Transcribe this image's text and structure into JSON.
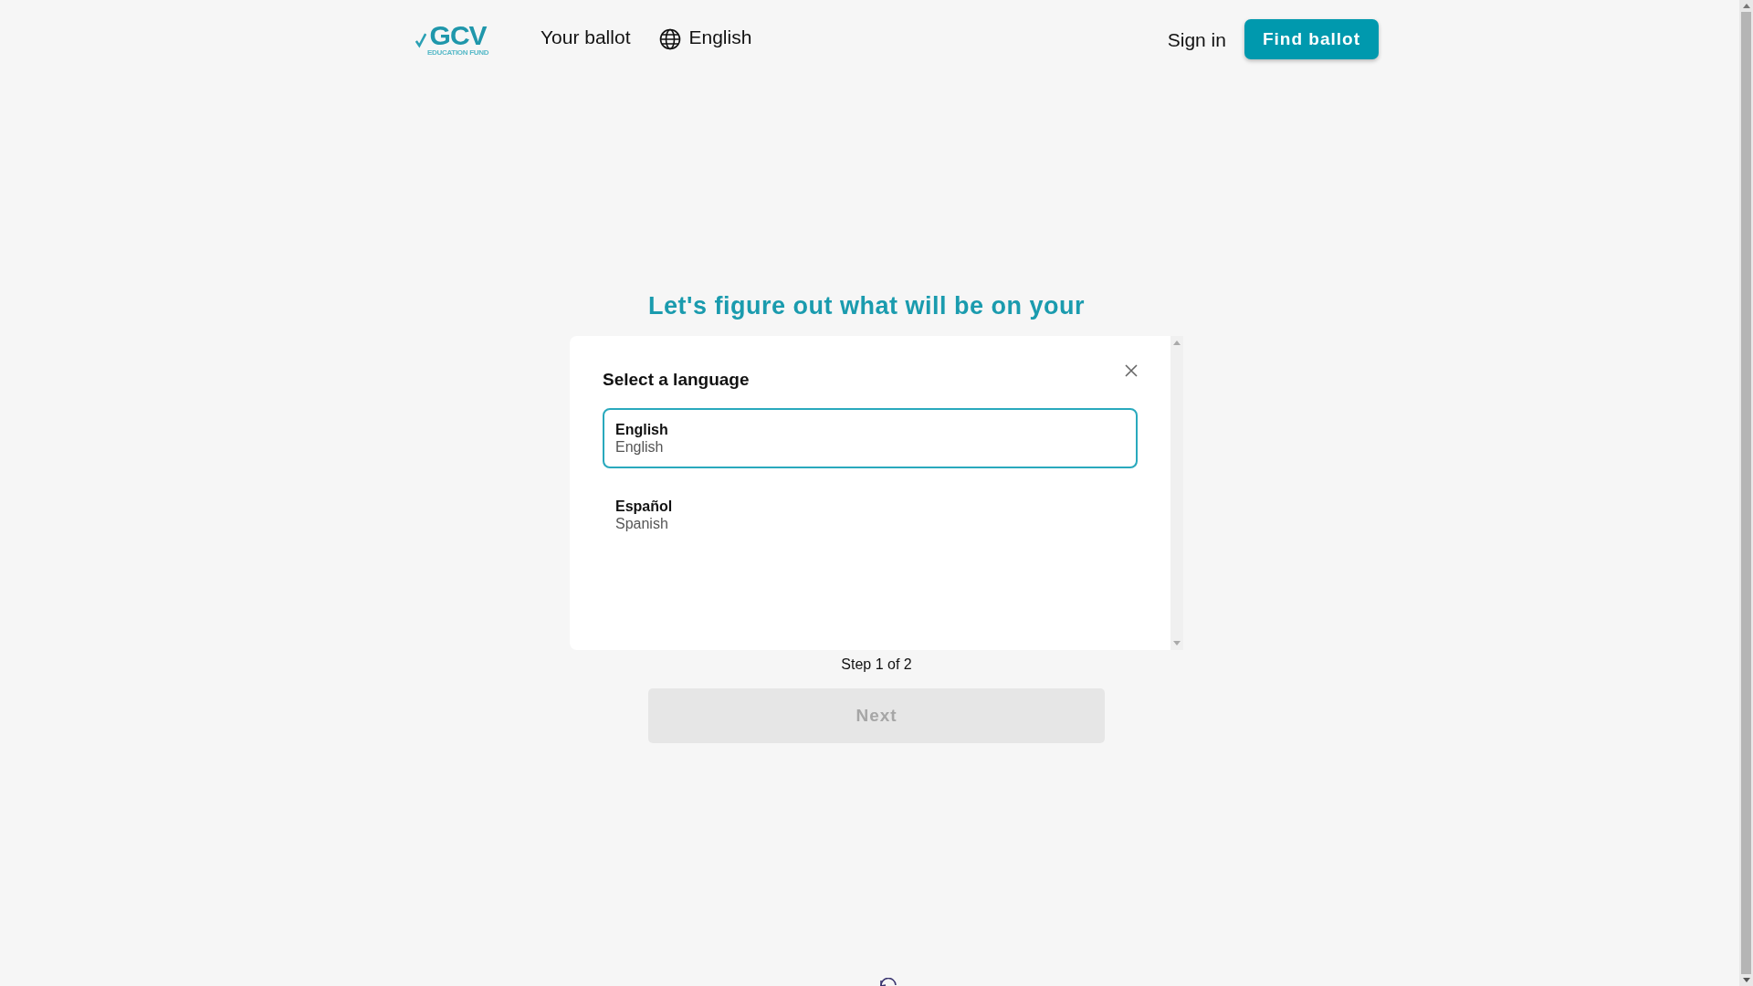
{
  "header": {
    "logo": {
      "mark": "GCV",
      "subtext": "EDUCATION FUND"
    },
    "nav": [
      {
        "label": "Your ballot",
        "kind": "link"
      },
      {
        "label": "English",
        "kind": "language"
      }
    ],
    "sign_in": "Sign in",
    "find_ballot": "Find ballot"
  },
  "main": {
    "heading": "Let's figure out what will be on your",
    "step": "Step 1 of 2",
    "next": {
      "label": "Next",
      "disabled": true
    }
  },
  "language_dialog": {
    "title": "Select a language",
    "options": [
      {
        "name": "English",
        "english_name": "English",
        "selected": true
      },
      {
        "name": "Español",
        "english_name": "Spanish",
        "selected": false
      }
    ]
  }
}
